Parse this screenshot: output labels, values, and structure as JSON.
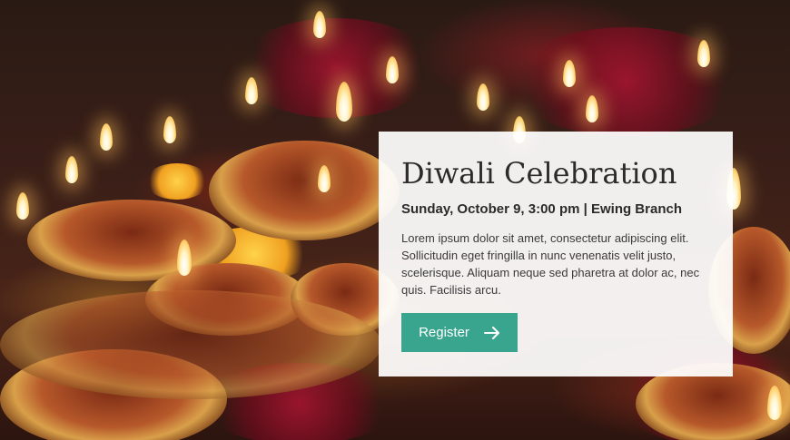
{
  "event": {
    "title": "Diwali Celebration",
    "meta": "Sunday, October 9, 3:00 pm | Ewing Branch",
    "description": "Lorem ipsum dolor sit amet, consectetur adipiscing elit. Sollicitudin eget fringilla in nunc venenatis velit justo, scelerisque. Aliquam neque sed pharetra at dolor ac, nec quis. Facilisis arcu."
  },
  "register_button": {
    "label": "Register",
    "icon": "arrow-right-icon",
    "color": "#3aa58e"
  },
  "hero_image": {
    "subject": "diya-lamps-photo"
  }
}
